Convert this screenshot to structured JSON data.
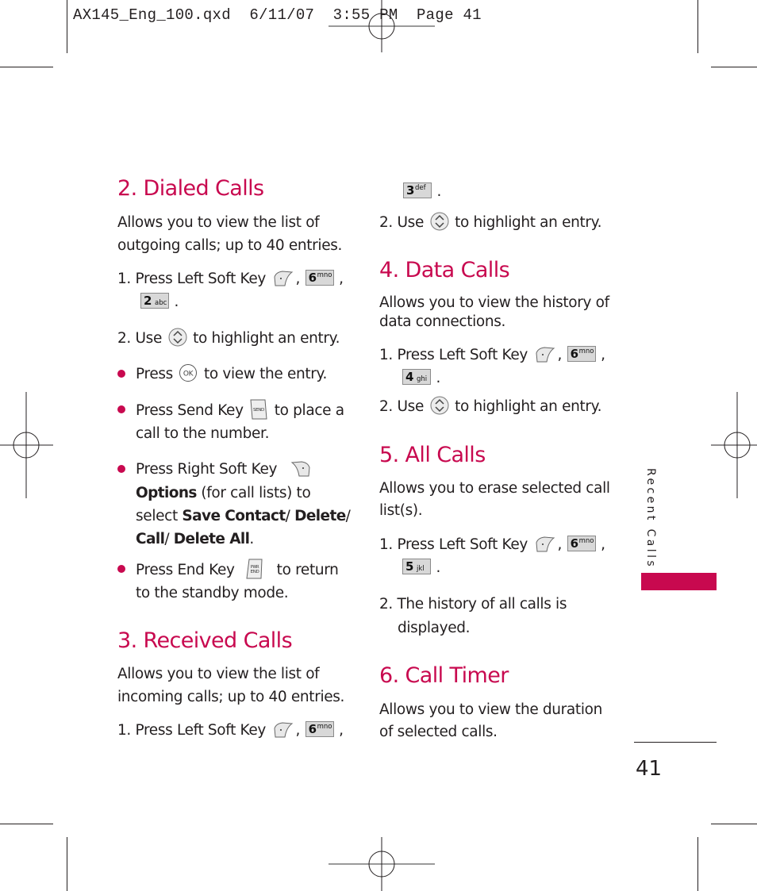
{
  "slug": "AX145_Eng_100.qxd  6/11/07  3:55 PM  Page 41",
  "sidebar": {
    "section_label": "Recent Calls",
    "accent_color": "#c8094f"
  },
  "page_number": "41",
  "sections": {
    "dialed": {
      "title": "2. Dialed Calls",
      "desc_1": "Allows you to view the list of",
      "desc_2": "outgoing calls; up to 40 entries.",
      "step1_text": "1. Press Left Soft Key",
      "step1_keys": [
        {
          "num": "6",
          "letters": "mno"
        },
        {
          "num": "2",
          "letters": "abc"
        }
      ],
      "step2_pre": "2.  Use",
      "step2_post": "to highlight an entry.",
      "bullet1_pre": "Press",
      "bullet1_post": "to view the entry.",
      "bullet2_pre": "Press Send Key",
      "bullet2_post": "to place a",
      "bullet2_line2": "call to the number.",
      "bullet3_line1": "Press Right Soft Key",
      "bullet3_opt": "Options",
      "bullet3_line2_rest": " (for call lists) to",
      "bullet3_select": "select ",
      "bullet3_save": "Save Contact",
      "bullet3_delete": "Delete",
      "bullet3_call": "Call",
      "bullet3_deleteall": "Delete All",
      "bullet4_pre": "Press End Key",
      "bullet4_post": "to return",
      "bullet4_line2": "to the standby mode."
    },
    "received": {
      "title": "3. Received Calls",
      "desc_1": "Allows you to view the list of",
      "desc_2": "incoming calls; up to 40 entries.",
      "step1_text": "1. Press Left Soft Key",
      "step1_keys": [
        {
          "num": "6",
          "letters": "mno"
        },
        {
          "num": "3",
          "letters": "def"
        }
      ],
      "step2_pre": "2. Use",
      "step2_post": "to highlight an entry."
    },
    "data": {
      "title": "4. Data Calls",
      "desc_1": "Allows you to view the history of",
      "desc_2": "data connections.",
      "step1_text": "1. Press Left Soft Key",
      "step1_keys": [
        {
          "num": "6",
          "letters": "mno"
        },
        {
          "num": "4",
          "letters": "ghi"
        }
      ],
      "step2_pre": "2. Use",
      "step2_post": "to highlight an entry."
    },
    "all": {
      "title": "5. All Calls",
      "desc_1": "Allows you to erase selected call",
      "desc_2": "list(s).",
      "step1_text": "1. Press Left Soft Key",
      "step1_keys": [
        {
          "num": "6",
          "letters": "mno"
        },
        {
          "num": "5",
          "letters": "jkl"
        }
      ],
      "step2_line1": "2. The history of all calls is",
      "step2_line2": "displayed."
    },
    "timer": {
      "title": "6. Call Timer",
      "desc_1": "Allows you to view the duration",
      "desc_2": "of selected calls."
    }
  },
  "icons": {
    "left_soft_key": "left-soft-key-icon",
    "right_soft_key": "right-soft-key-icon",
    "nav_key": "navigation-key-icon",
    "ok_key": "ok-key-icon",
    "send_key": "send-key-icon",
    "end_key": "end-key-icon",
    "ok_label": "OK",
    "send_label": "SEND",
    "end_label_top": "PWR",
    "end_label_bottom": "END"
  },
  "punct": {
    "comma": ",",
    "period": ".",
    "slash": "/ "
  }
}
